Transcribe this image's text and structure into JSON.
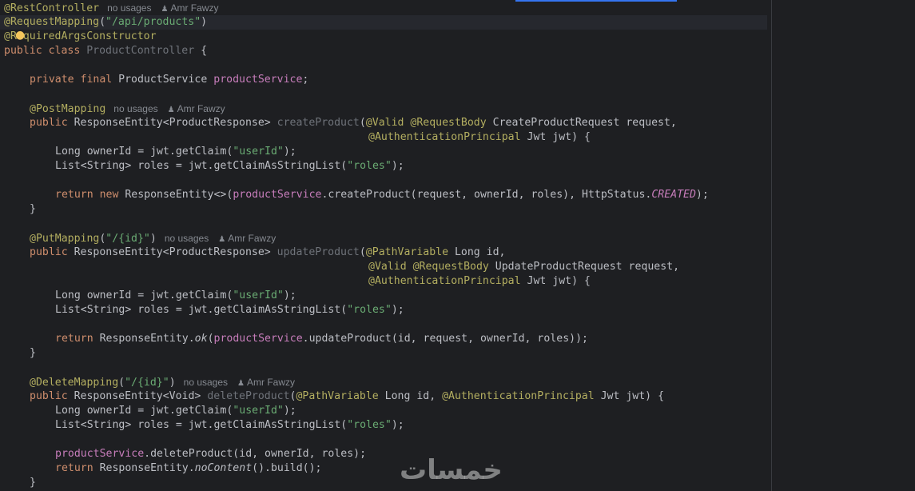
{
  "editor": {
    "hints": {
      "no_usages": "no usages",
      "author": "Amr Fawzy"
    },
    "watermark": "خمسات",
    "code": {
      "l1_ann": "@RestController",
      "l2_ann": "@RequestMapping",
      "l2_open": "(",
      "l2_str": "\"/api/products\"",
      "l2_close": ")",
      "l3_ann_a": "@",
      "l3_ann_b": "RequiredArgsConstructor",
      "l4_kw": "public class ",
      "l4_name": "ProductController",
      "l4_brace": " {",
      "l6_kw": "private final ",
      "l6_type": "ProductService ",
      "l6_field": "productService",
      "l6_end": ";",
      "post_ann": "@PostMapping",
      "create_kw": "public ",
      "create_type": "ResponseEntity<ProductResponse> ",
      "create_name": "createProduct",
      "create_open": "(",
      "create_ann1": "@Valid @RequestBody ",
      "create_param1": "CreateProductRequest request,",
      "create_ann2": "@AuthenticationPrincipal ",
      "create_param2": "Jwt jwt) {",
      "owner_a": "Long ownerId = jwt.getClaim(",
      "owner_str": "\"userId\"",
      "owner_end": ");",
      "roles_a": "List<String> roles = jwt.getClaimAsStringList(",
      "roles_str": "\"roles\"",
      "roles_end": ");",
      "create_ret_kw": "return new ",
      "create_ret_a": "ResponseEntity<>(",
      "create_ret_field": "productService",
      "create_ret_b": ".createProduct(request, ownerId, roles), HttpStatus.",
      "create_ret_const": "CREATED",
      "create_ret_end": ");",
      "close_brace": "}",
      "put_ann": "@PutMapping",
      "put_open": "(",
      "put_str": "\"/{id}\"",
      "put_close": ")",
      "update_name": "updateProduct",
      "update_ann1": "@PathVariable ",
      "update_param1": "Long id,",
      "update_ann2": "@Valid @RequestBody ",
      "update_param2": "UpdateProductRequest request,",
      "update_ann3": "@AuthenticationPrincipal ",
      "update_param3": "Jwt jwt) {",
      "ret_kw": "return ",
      "update_ret_a": "ResponseEntity.",
      "update_ret_ok": "ok",
      "update_ret_b": "(",
      "update_ret_field": "productService",
      "update_ret_c": ".updateProduct(id, request, ownerId, roles));",
      "delete_ann": "@DeleteMapping",
      "delete_type": "ResponseEntity<Void> ",
      "delete_name": "deleteProduct",
      "delete_ann1": "@PathVariable ",
      "delete_param1": "Long id, ",
      "delete_ann2": "@AuthenticationPrincipal ",
      "delete_param2": "Jwt jwt) {",
      "delete_call_field": "productService",
      "delete_call": ".deleteProduct(id, ownerId, roles);",
      "delete_ret_a": "ResponseEntity.",
      "delete_ret_nc": "noContent",
      "delete_ret_b": "().build();"
    }
  }
}
